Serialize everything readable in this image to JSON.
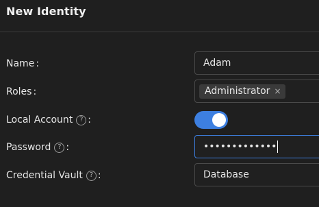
{
  "dialog": {
    "title": "New Identity"
  },
  "form": {
    "name": {
      "label": "Name",
      "value": "Adam"
    },
    "roles": {
      "label": "Roles",
      "chip": "Administrator",
      "chip_remove": "×"
    },
    "local_account": {
      "label": "Local Account",
      "help": "?",
      "enabled": true
    },
    "password": {
      "label": "Password",
      "help": "?",
      "masked_value": "•••••••••••••"
    },
    "credential_vault": {
      "label": "Credential Vault",
      "help": "?",
      "value": "Database"
    }
  },
  "colors": {
    "accent": "#3d7fe0",
    "background": "#1f1f1f"
  }
}
